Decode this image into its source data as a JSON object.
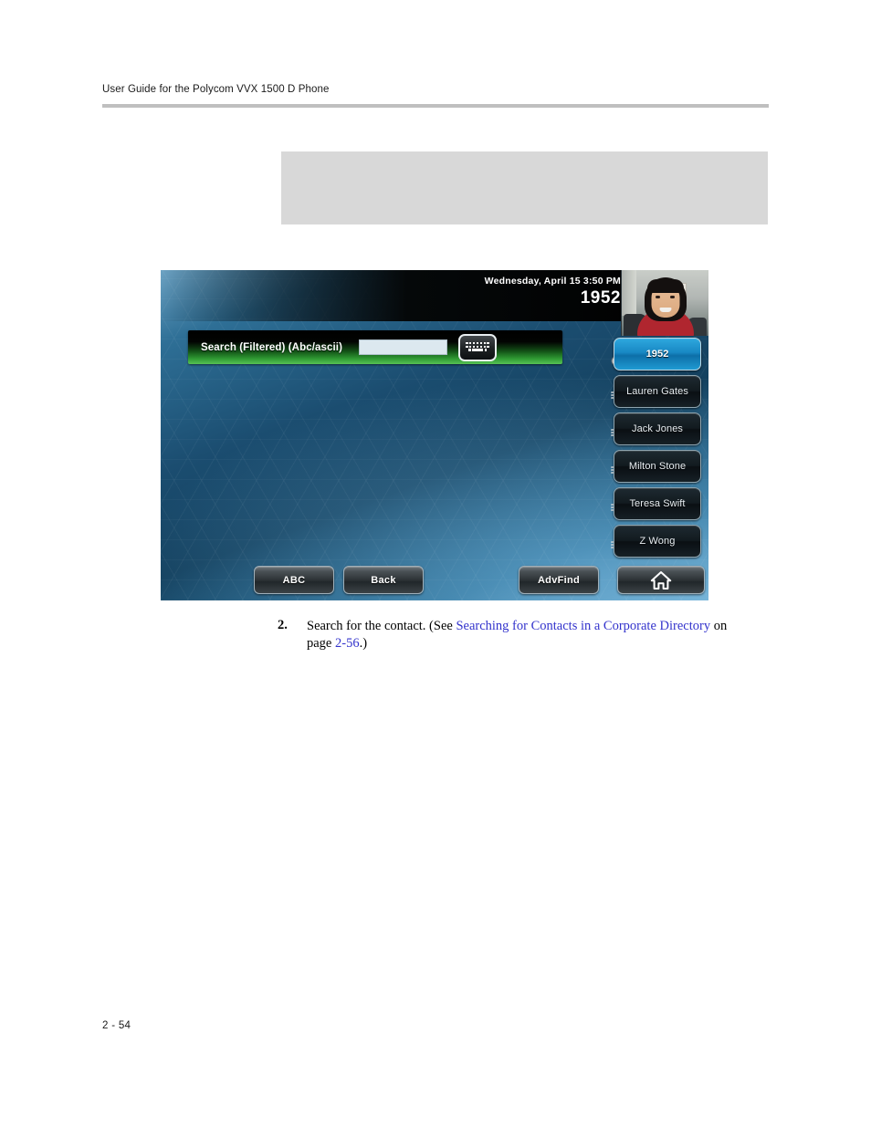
{
  "document": {
    "header_title": "User Guide for the Polycom VVX 1500 D Phone",
    "page_number": "2 - 54"
  },
  "grey_block": {
    "content": ""
  },
  "phone_screen": {
    "status_bar": {
      "datetime": "Wednesday, April 15  3:50 PM",
      "extension": "1952"
    },
    "video_thumbnail": {
      "name": "video-self-view"
    },
    "search": {
      "label": "Search (Filtered) (Abc/ascii)",
      "value": "",
      "placeholder": "",
      "keyboard_icon": "keyboard-icon"
    },
    "contacts": [
      {
        "label": "1952",
        "icon": "handset-checkmark-icon",
        "selected": true
      },
      {
        "label": "Lauren Gates",
        "icon": "handset-lines-icon",
        "selected": false
      },
      {
        "label": "Jack Jones",
        "icon": "handset-lines-icon",
        "selected": false
      },
      {
        "label": "Milton Stone",
        "icon": "handset-lines-icon",
        "selected": false
      },
      {
        "label": "Teresa Swift",
        "icon": "handset-lines-icon",
        "selected": false
      },
      {
        "label": "Z Wong",
        "icon": "handset-lines-icon",
        "selected": false
      }
    ],
    "softkeys": [
      {
        "label": "ABC"
      },
      {
        "label": "Back"
      },
      {
        "label": "AdvFind"
      },
      {
        "label": "",
        "icon": "home-icon"
      }
    ]
  },
  "step": {
    "number": "2.",
    "text_before": "Search for the contact. (See ",
    "link_text": "Searching for Contacts in a Corporate Directory",
    "text_middle": " on page ",
    "link_page": "2-56",
    "text_after": ".)"
  },
  "colors": {
    "link": "#3333CC",
    "rule": "#BFBFBF",
    "grey_block": "#D8D8D8",
    "screen_accent": "#2EA8DE",
    "search_green": "#2F9A33"
  }
}
